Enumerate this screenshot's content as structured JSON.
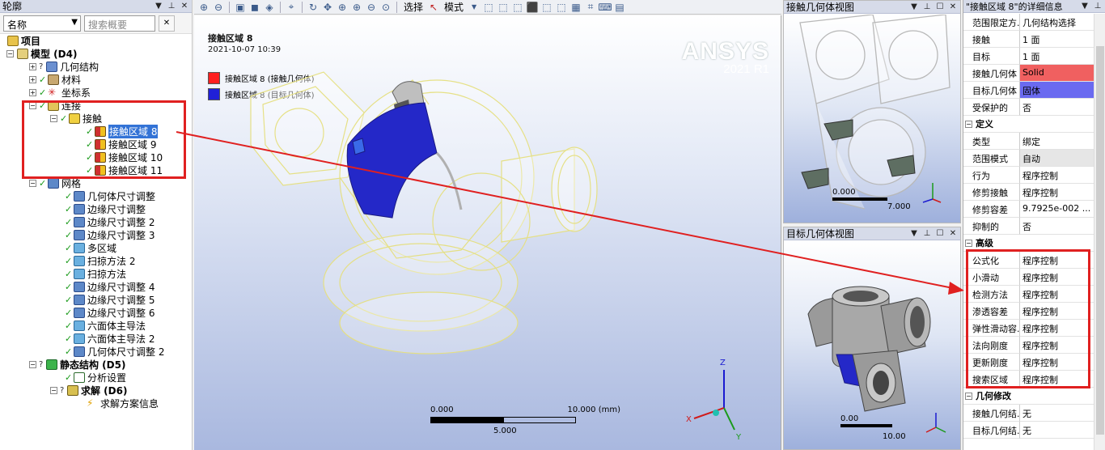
{
  "outline": {
    "title": "轮廓",
    "filter_select": "名称",
    "search_placeholder": "搜索概要",
    "tree": [
      {
        "label": "项目",
        "bold": true
      },
      {
        "label": "模型 (D4)",
        "bold": true
      },
      {
        "label": "几何结构"
      },
      {
        "label": "材料"
      },
      {
        "label": "坐标系"
      },
      {
        "label": "连接"
      },
      {
        "label": "接触"
      },
      {
        "label": "接触区域 8",
        "selected": true
      },
      {
        "label": "接触区域 9"
      },
      {
        "label": "接触区域 10"
      },
      {
        "label": "接触区域 11"
      },
      {
        "label": "网格"
      },
      {
        "label": "几何体尺寸调整"
      },
      {
        "label": "边缘尺寸调整"
      },
      {
        "label": "边缘尺寸调整 2"
      },
      {
        "label": "边缘尺寸调整 3"
      },
      {
        "label": "多区域"
      },
      {
        "label": "扫掠方法 2"
      },
      {
        "label": "扫掠方法"
      },
      {
        "label": "边缘尺寸调整 4"
      },
      {
        "label": "边缘尺寸调整 5"
      },
      {
        "label": "边缘尺寸调整 6"
      },
      {
        "label": "六面体主导法"
      },
      {
        "label": "六面体主导法 2"
      },
      {
        "label": "几何体尺寸调整 2"
      },
      {
        "label": "静态结构 (D5)",
        "bold": true
      },
      {
        "label": "分析设置"
      },
      {
        "label": "求解 (D6)",
        "bold": true
      },
      {
        "label": "求解方案信息"
      }
    ]
  },
  "toolbar": {
    "select_label": "选择",
    "mode_label": "模式"
  },
  "viewport": {
    "title": "接触区域 8",
    "date": "2021-10-07 10:39",
    "legend": [
      {
        "label": "接触区域 8 (接触几何体)",
        "color": "#ff2020"
      },
      {
        "label": "接触区域 8 (目标几何体)",
        "color": "#2020d8"
      }
    ],
    "brand": "ANSYS",
    "version": "2021 R1",
    "scale_start": "0.000",
    "scale_end": "10.000 (mm)",
    "scale_mid": "5.000",
    "axes": {
      "x": "X",
      "y": "Y",
      "z": "Z"
    }
  },
  "contact_view": {
    "title": "接触几何体视图",
    "scale_start": "0.000",
    "scale_end": "7.000"
  },
  "target_view": {
    "title": "目标几何体视图",
    "scale_start": "0.00",
    "scale_end": "10.00"
  },
  "details": {
    "title": "\"接触区域 8\"的详细信息",
    "rows_top": [
      {
        "k": "范围限定方...",
        "v": "几何结构选择"
      },
      {
        "k": "接触",
        "v": "1 面"
      },
      {
        "k": "目标",
        "v": "1 面"
      },
      {
        "k": "接触几何体",
        "v": "Solid",
        "bg": "#f06060"
      },
      {
        "k": "目标几何体",
        "v": "固体",
        "bg": "#6a6af0"
      },
      {
        "k": "受保护的",
        "v": "否"
      }
    ],
    "section_def": "定义",
    "rows_def": [
      {
        "k": "类型",
        "v": "绑定"
      },
      {
        "k": "范围模式",
        "v": "自动",
        "bg": "#e6e6e6"
      },
      {
        "k": "行为",
        "v": "程序控制"
      },
      {
        "k": "修剪接触",
        "v": "程序控制"
      },
      {
        "k": "修剪容差",
        "v": "9.7925e-002 ..."
      },
      {
        "k": "抑制的",
        "v": "否"
      }
    ],
    "section_adv": "高级",
    "rows_adv": [
      {
        "k": "公式化",
        "v": "程序控制"
      },
      {
        "k": "小滑动",
        "v": "程序控制"
      },
      {
        "k": "检测方法",
        "v": "程序控制"
      },
      {
        "k": "渗透容差",
        "v": "程序控制"
      },
      {
        "k": "弹性滑动容...",
        "v": "程序控制"
      },
      {
        "k": "法向刚度",
        "v": "程序控制"
      },
      {
        "k": "更新刚度",
        "v": "程序控制"
      },
      {
        "k": "搜索区域",
        "v": "程序控制"
      }
    ],
    "section_geo": "几何修改",
    "rows_geo": [
      {
        "k": "接触几何结...",
        "v": "无"
      },
      {
        "k": "目标几何结...",
        "v": "无"
      }
    ]
  }
}
